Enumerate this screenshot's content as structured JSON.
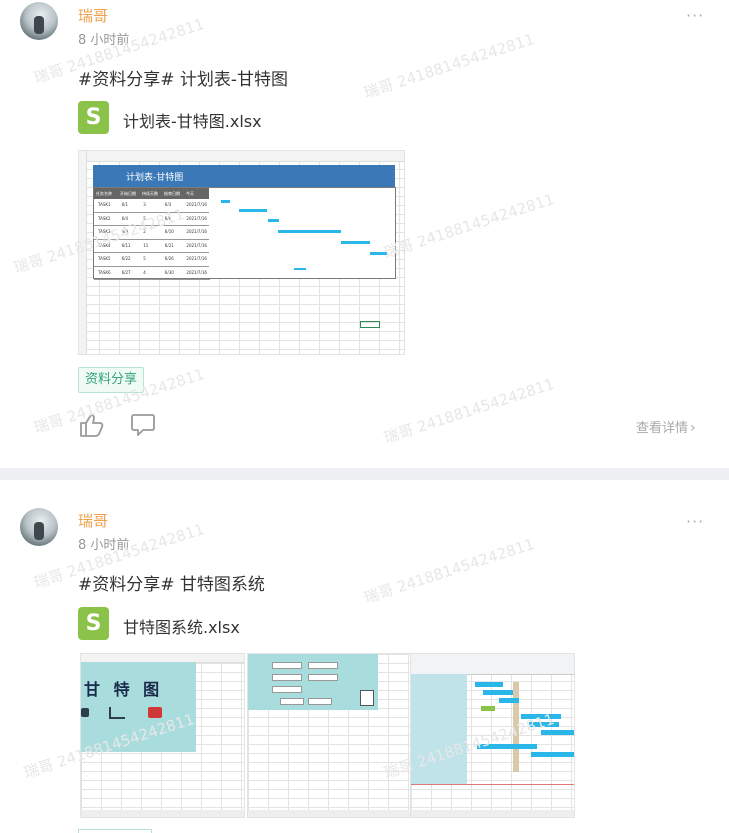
{
  "posts": [
    {
      "author": "瑞哥",
      "time": "8 小时前",
      "more": "···",
      "title": "#资料分享# 计划表-甘特图",
      "file_icon": "S",
      "file_name": "计划表-甘特图.xlsx",
      "sheet": {
        "title": "计划表-甘特图",
        "headers": [
          "任务名称",
          "开始日期",
          "持续天数",
          "结束日期",
          "今天"
        ],
        "rows": [
          [
            "TASK1",
            "6/1",
            "3",
            "6/3",
            "2021/7/16"
          ],
          [
            "TASK2",
            "6/4",
            "5",
            "6/8",
            "2021/7/16"
          ],
          [
            "TASK3",
            "6/9",
            "2",
            "6/10",
            "2021/7/16"
          ],
          [
            "TASK4",
            "6/11",
            "11",
            "6/21",
            "2021/7/16"
          ],
          [
            "TASK5",
            "6/22",
            "5",
            "6/26",
            "2021/7/16"
          ],
          [
            "TASK6",
            "6/27",
            "4",
            "6/30",
            "2021/7/16"
          ]
        ]
      },
      "tag": "资料分享",
      "like_icon": "thumbs-up-icon",
      "comment_icon": "comment-icon",
      "detail_label": "查看详情"
    },
    {
      "author": "瑞哥",
      "time": "8 小时前",
      "more": "···",
      "title": "#资料分享# 甘特图系统",
      "file_icon": "S",
      "file_name": "甘特图系统.xlsx",
      "sheet1_title": "甘 特 图"
    }
  ],
  "watermark": "瑞哥 241881454242811",
  "colors": {
    "author": "#f0a04b",
    "tag_text": "#2fa472",
    "sheet_header": "#3a78b8",
    "gantt_bar": "#29b6e8",
    "file_icon": "#8bc34a"
  }
}
